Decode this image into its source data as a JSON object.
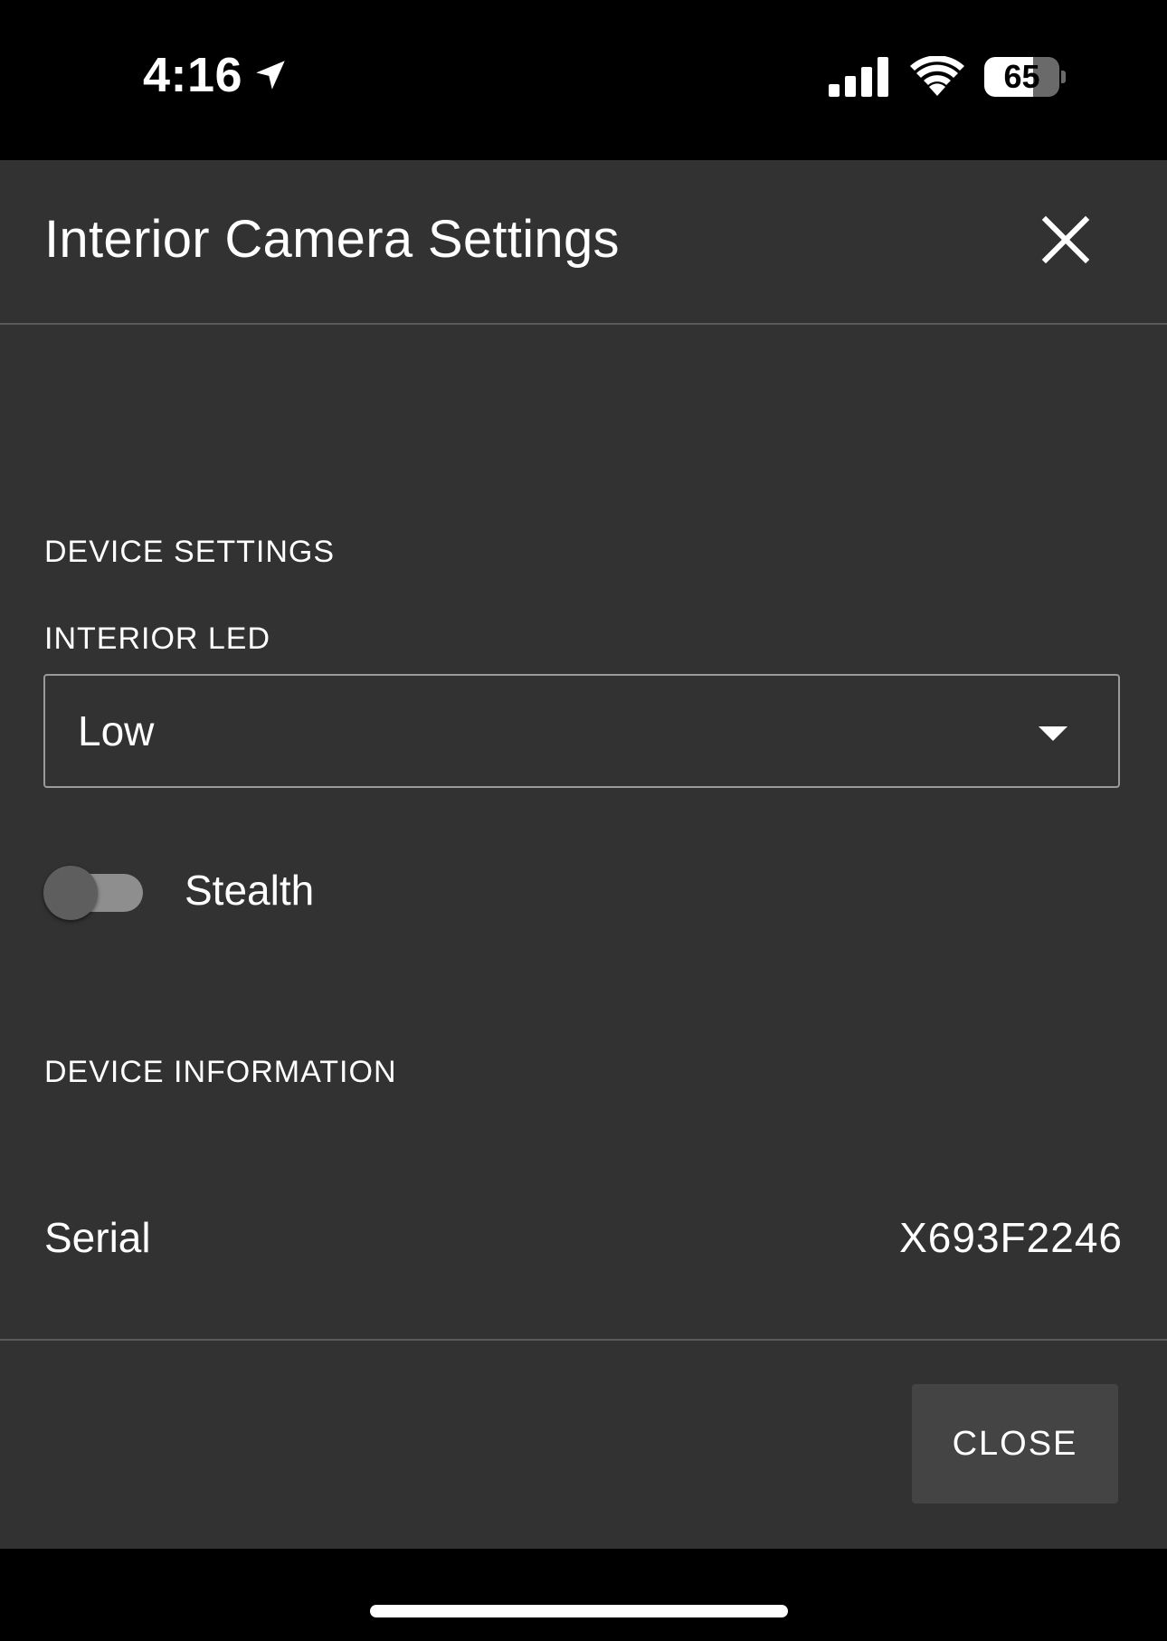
{
  "status_bar": {
    "time": "4:16",
    "battery_percent": "65",
    "battery_level": 0.65,
    "icons": [
      "location-arrow-icon",
      "cellular-signal-icon",
      "wifi-icon",
      "battery-icon"
    ]
  },
  "dialog": {
    "title": "Interior Camera Settings",
    "close_icon": "close-icon",
    "device_settings": {
      "heading": "DEVICE SETTINGS",
      "interior_led": {
        "label": "INTERIOR LED",
        "selected": "Low"
      },
      "stealth": {
        "label": "Stealth",
        "enabled": false
      }
    },
    "device_information": {
      "heading": "DEVICE INFORMATION",
      "serial": {
        "label": "Serial",
        "value": "X693F2246"
      }
    },
    "footer": {
      "close_label": "CLOSE"
    }
  },
  "colors": {
    "dialog_background": "#323232",
    "divider": "#5a5a5a",
    "button_background": "#444444",
    "toggle_track": "#8e8e8e",
    "toggle_knob": "#5e5e5e"
  }
}
